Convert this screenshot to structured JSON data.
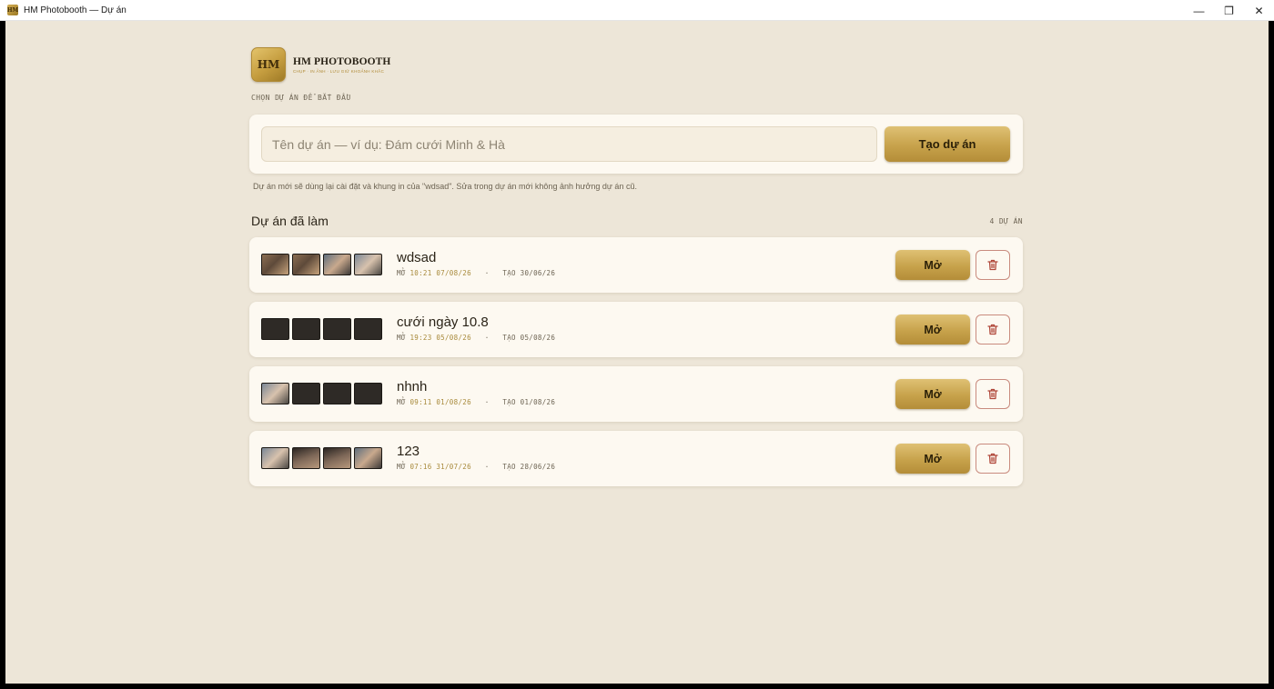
{
  "window": {
    "icon_text": "HM",
    "title": "HM Photobooth — Dự án",
    "minimize": "—",
    "restore": "❐",
    "close": "✕"
  },
  "brand": {
    "logo_text": "HM",
    "name": "HM PHOTOBOOTH",
    "tagline": "CHỤP · IN ẢNH · LƯU GIỮ KHOẢNH KHẮC"
  },
  "choose_label": "CHỌN DỰ ÁN ĐỂ BẮT ĐẦU",
  "create": {
    "placeholder": "Tên dự án — ví dụ: Đám cưới Minh & Hà",
    "value": "",
    "button_label": "Tạo dự án"
  },
  "hint": "Dự án mới sẽ dùng lại cài đặt và khung in của \"wdsad\". Sửa trong dự án mới không ảnh hưởng dự án cũ.",
  "projects_section": {
    "title": "Dự án đã làm",
    "count": "4 DỰ ÁN"
  },
  "projects": [
    {
      "name": "wdsad",
      "opened_label": "MỞ",
      "opened": "10:21 07/08/26",
      "created_label": "TẠO",
      "created": "30/06/26",
      "open_label": "Mở",
      "thumbs": [
        "photo",
        "photo",
        "photo2",
        "photo4"
      ]
    },
    {
      "name": "cưới ngày 10.8",
      "opened_label": "MỞ",
      "opened": "19:23 05/08/26",
      "created_label": "TẠO",
      "created": "05/08/26",
      "open_label": "Mở",
      "thumbs": [
        "empty",
        "empty",
        "empty",
        "empty"
      ]
    },
    {
      "name": "nhnh",
      "opened_label": "MỞ",
      "opened": "09:11 01/08/26",
      "created_label": "TẠO",
      "created": "01/08/26",
      "open_label": "Mở",
      "thumbs": [
        "photo4",
        "empty",
        "empty",
        "empty"
      ]
    },
    {
      "name": "123",
      "opened_label": "MỞ",
      "opened": "07:16 31/07/26",
      "created_label": "TẠO",
      "created": "28/06/26",
      "open_label": "Mở",
      "thumbs": [
        "photo4",
        "photo3",
        "photo3",
        "photo2"
      ]
    }
  ],
  "colors": {
    "background": "#ede6d8",
    "card": "#fdf9f1",
    "accent_gold": "#c7a24b",
    "danger": "#b0473a",
    "text": "#2b2418"
  }
}
